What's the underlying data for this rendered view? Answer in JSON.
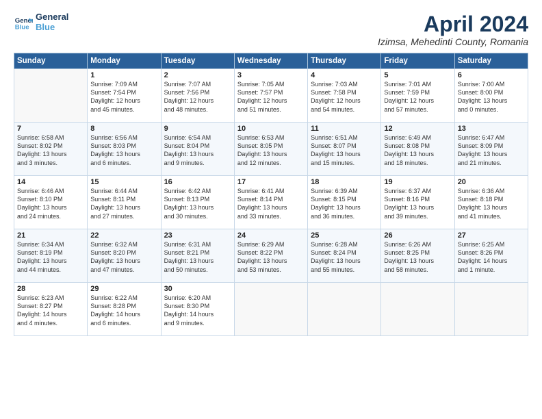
{
  "logo": {
    "line1": "General",
    "line2": "Blue"
  },
  "title": "April 2024",
  "subtitle": "Izimsa, Mehedinti County, Romania",
  "header_days": [
    "Sunday",
    "Monday",
    "Tuesday",
    "Wednesday",
    "Thursday",
    "Friday",
    "Saturday"
  ],
  "weeks": [
    [
      {
        "day": "",
        "text": ""
      },
      {
        "day": "1",
        "text": "Sunrise: 7:09 AM\nSunset: 7:54 PM\nDaylight: 12 hours\nand 45 minutes."
      },
      {
        "day": "2",
        "text": "Sunrise: 7:07 AM\nSunset: 7:56 PM\nDaylight: 12 hours\nand 48 minutes."
      },
      {
        "day": "3",
        "text": "Sunrise: 7:05 AM\nSunset: 7:57 PM\nDaylight: 12 hours\nand 51 minutes."
      },
      {
        "day": "4",
        "text": "Sunrise: 7:03 AM\nSunset: 7:58 PM\nDaylight: 12 hours\nand 54 minutes."
      },
      {
        "day": "5",
        "text": "Sunrise: 7:01 AM\nSunset: 7:59 PM\nDaylight: 12 hours\nand 57 minutes."
      },
      {
        "day": "6",
        "text": "Sunrise: 7:00 AM\nSunset: 8:00 PM\nDaylight: 13 hours\nand 0 minutes."
      }
    ],
    [
      {
        "day": "7",
        "text": "Sunrise: 6:58 AM\nSunset: 8:02 PM\nDaylight: 13 hours\nand 3 minutes."
      },
      {
        "day": "8",
        "text": "Sunrise: 6:56 AM\nSunset: 8:03 PM\nDaylight: 13 hours\nand 6 minutes."
      },
      {
        "day": "9",
        "text": "Sunrise: 6:54 AM\nSunset: 8:04 PM\nDaylight: 13 hours\nand 9 minutes."
      },
      {
        "day": "10",
        "text": "Sunrise: 6:53 AM\nSunset: 8:05 PM\nDaylight: 13 hours\nand 12 minutes."
      },
      {
        "day": "11",
        "text": "Sunrise: 6:51 AM\nSunset: 8:07 PM\nDaylight: 13 hours\nand 15 minutes."
      },
      {
        "day": "12",
        "text": "Sunrise: 6:49 AM\nSunset: 8:08 PM\nDaylight: 13 hours\nand 18 minutes."
      },
      {
        "day": "13",
        "text": "Sunrise: 6:47 AM\nSunset: 8:09 PM\nDaylight: 13 hours\nand 21 minutes."
      }
    ],
    [
      {
        "day": "14",
        "text": "Sunrise: 6:46 AM\nSunset: 8:10 PM\nDaylight: 13 hours\nand 24 minutes."
      },
      {
        "day": "15",
        "text": "Sunrise: 6:44 AM\nSunset: 8:11 PM\nDaylight: 13 hours\nand 27 minutes."
      },
      {
        "day": "16",
        "text": "Sunrise: 6:42 AM\nSunset: 8:13 PM\nDaylight: 13 hours\nand 30 minutes."
      },
      {
        "day": "17",
        "text": "Sunrise: 6:41 AM\nSunset: 8:14 PM\nDaylight: 13 hours\nand 33 minutes."
      },
      {
        "day": "18",
        "text": "Sunrise: 6:39 AM\nSunset: 8:15 PM\nDaylight: 13 hours\nand 36 minutes."
      },
      {
        "day": "19",
        "text": "Sunrise: 6:37 AM\nSunset: 8:16 PM\nDaylight: 13 hours\nand 39 minutes."
      },
      {
        "day": "20",
        "text": "Sunrise: 6:36 AM\nSunset: 8:18 PM\nDaylight: 13 hours\nand 41 minutes."
      }
    ],
    [
      {
        "day": "21",
        "text": "Sunrise: 6:34 AM\nSunset: 8:19 PM\nDaylight: 13 hours\nand 44 minutes."
      },
      {
        "day": "22",
        "text": "Sunrise: 6:32 AM\nSunset: 8:20 PM\nDaylight: 13 hours\nand 47 minutes."
      },
      {
        "day": "23",
        "text": "Sunrise: 6:31 AM\nSunset: 8:21 PM\nDaylight: 13 hours\nand 50 minutes."
      },
      {
        "day": "24",
        "text": "Sunrise: 6:29 AM\nSunset: 8:22 PM\nDaylight: 13 hours\nand 53 minutes."
      },
      {
        "day": "25",
        "text": "Sunrise: 6:28 AM\nSunset: 8:24 PM\nDaylight: 13 hours\nand 55 minutes."
      },
      {
        "day": "26",
        "text": "Sunrise: 6:26 AM\nSunset: 8:25 PM\nDaylight: 13 hours\nand 58 minutes."
      },
      {
        "day": "27",
        "text": "Sunrise: 6:25 AM\nSunset: 8:26 PM\nDaylight: 14 hours\nand 1 minute."
      }
    ],
    [
      {
        "day": "28",
        "text": "Sunrise: 6:23 AM\nSunset: 8:27 PM\nDaylight: 14 hours\nand 4 minutes."
      },
      {
        "day": "29",
        "text": "Sunrise: 6:22 AM\nSunset: 8:28 PM\nDaylight: 14 hours\nand 6 minutes."
      },
      {
        "day": "30",
        "text": "Sunrise: 6:20 AM\nSunset: 8:30 PM\nDaylight: 14 hours\nand 9 minutes."
      },
      {
        "day": "",
        "text": ""
      },
      {
        "day": "",
        "text": ""
      },
      {
        "day": "",
        "text": ""
      },
      {
        "day": "",
        "text": ""
      }
    ]
  ]
}
